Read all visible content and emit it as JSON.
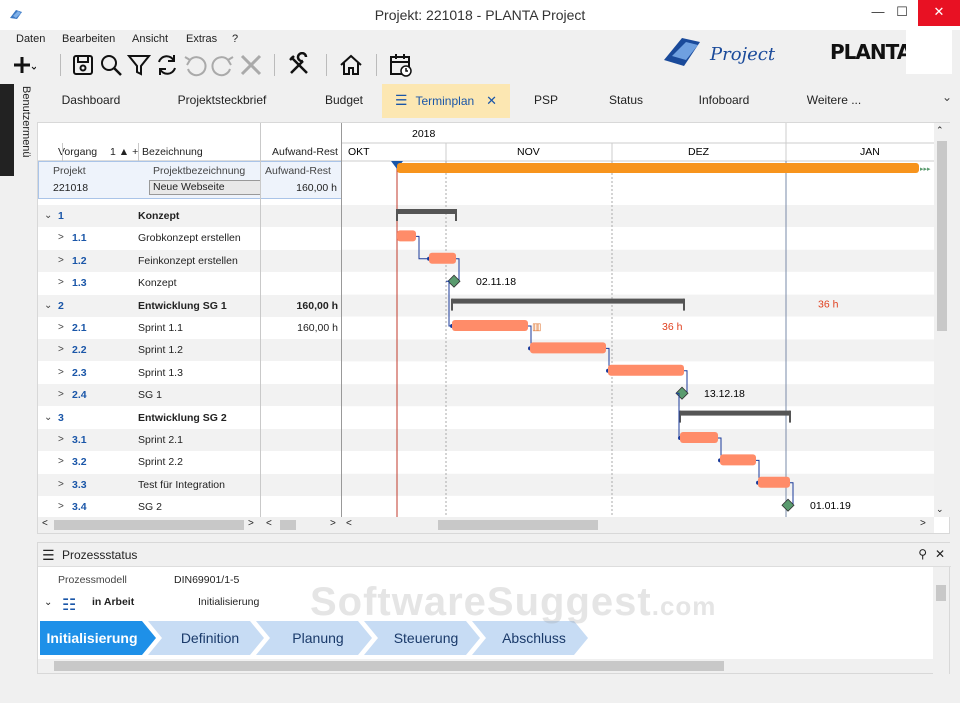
{
  "window": {
    "title": "Projekt: 221018 - PLANTA Project"
  },
  "menu": [
    "Daten",
    "Bearbeiten",
    "Ansicht",
    "Extras",
    "?"
  ],
  "logos": {
    "project_logo_text": "Project",
    "brand_text": "PLANTA"
  },
  "sidebar": {
    "label": "Benutzermenü"
  },
  "tabs": [
    {
      "label": "Dashboard"
    },
    {
      "label": "Projektsteckbrief"
    },
    {
      "label": "Budget"
    },
    {
      "label": "Terminplan",
      "active": true
    },
    {
      "label": "PSP"
    },
    {
      "label": "Status"
    },
    {
      "label": "Infoboard"
    },
    {
      "label": "Weitere ..."
    }
  ],
  "grid": {
    "year": "2018",
    "months": [
      "OKT",
      "NOV",
      "DEZ",
      "JAN"
    ],
    "headers": {
      "vorgang": "Vorgang",
      "sort": "1",
      "bezeichnung": "Bezeichnung",
      "aufwand": "Aufwand-Rest"
    },
    "project": {
      "label_projekt": "Projekt",
      "label_bezeichnung": "Projektbezeichnung",
      "label_aufwand": "Aufwand-Rest",
      "id": "221018",
      "name": "Neue Webseite",
      "aufwand": "160,00 h"
    },
    "rows": [
      {
        "exp": "⌄",
        "num": "1",
        "name": "Konzept",
        "bold": true,
        "aufwand": ""
      },
      {
        "exp": ">",
        "num": "1.1",
        "name": "Grobkonzept erstellen",
        "aufwand": ""
      },
      {
        "exp": ">",
        "num": "1.2",
        "name": "Feinkonzept erstellen",
        "aufwand": ""
      },
      {
        "exp": ">",
        "num": "1.3",
        "name": "Konzept",
        "aufwand": ""
      },
      {
        "exp": "⌄",
        "num": "2",
        "name": "Entwicklung SG 1",
        "bold": true,
        "aufwand": "160,00 h"
      },
      {
        "exp": ">",
        "num": "2.1",
        "name": "Sprint 1.1",
        "aufwand": "160,00 h"
      },
      {
        "exp": ">",
        "num": "2.2",
        "name": "Sprint 1.2",
        "aufwand": ""
      },
      {
        "exp": ">",
        "num": "2.3",
        "name": "Sprint 1.3",
        "aufwand": ""
      },
      {
        "exp": ">",
        "num": "2.4",
        "name": "SG 1",
        "aufwand": ""
      },
      {
        "exp": "⌄",
        "num": "3",
        "name": "Entwicklung SG 2",
        "bold": true,
        "aufwand": ""
      },
      {
        "exp": ">",
        "num": "3.1",
        "name": "Sprint 2.1",
        "aufwand": ""
      },
      {
        "exp": ">",
        "num": "3.2",
        "name": "Sprint 2.2",
        "aufwand": ""
      },
      {
        "exp": ">",
        "num": "3.3",
        "name": "Test für  Integration",
        "aufwand": ""
      },
      {
        "exp": ">",
        "num": "3.4",
        "name": "SG 2",
        "aufwand": ""
      }
    ]
  },
  "milestones": [
    "02.11.18",
    "13.12.18",
    "01.01.19"
  ],
  "effort_labels": [
    "36 h",
    "36 h"
  ],
  "colors": {
    "task_bar": "#ff8c69",
    "project_bar": "#f7941d",
    "summary_bar": "#555555",
    "milestone": "#5a9b6e",
    "today_line": "#c0392b",
    "active_tab": "#fce7b2",
    "accent": "#1a56a8"
  },
  "prozess": {
    "title": "Prozessstatus",
    "modell_label": "Prozessmodell",
    "modell_value": "DIN69901/1-5",
    "status_label": "in Arbeit",
    "status_value": "Initialisierung",
    "steps": [
      "Initialisierung",
      "Definition",
      "Planung",
      "Steuerung",
      "Abschluss"
    ],
    "active_step": 0
  },
  "watermark": {
    "main": "SoftwareSuggest",
    "suffix": ".com"
  }
}
